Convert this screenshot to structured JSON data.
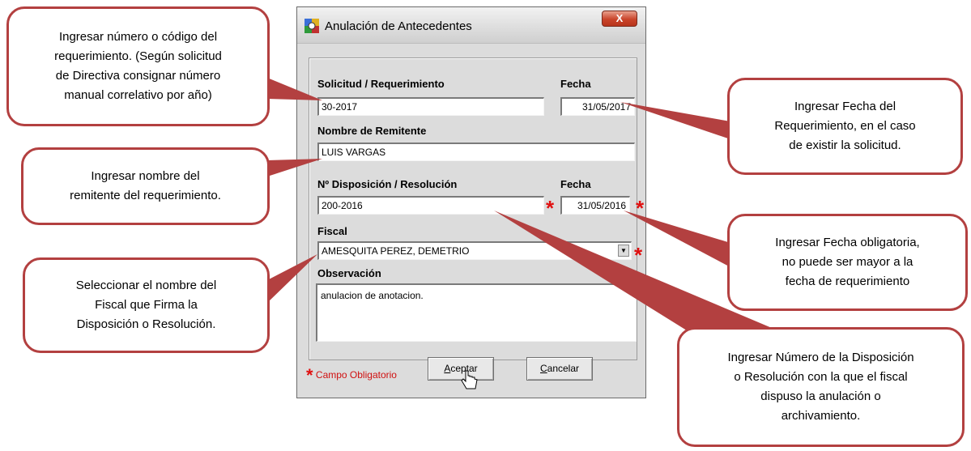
{
  "dialog": {
    "title": "Anulación de Antecedentes",
    "close_symbol": "X",
    "icon": "app-icon"
  },
  "form": {
    "solicitud_label": "Solicitud / Requerimiento",
    "solicitud_value": "30-2017",
    "fecha1_label": "Fecha",
    "fecha1_value": "31/05/2017",
    "remitente_label": "Nombre de Remitente",
    "remitente_value": "LUIS VARGAS",
    "disposicion_label": "Nº Disposición / Resolución",
    "disposicion_value": "200-2016",
    "fecha2_label": "Fecha",
    "fecha2_value": "31/05/2016",
    "fiscal_label": "Fiscal",
    "fiscal_value": "AMESQUITA PEREZ, DEMETRIO",
    "observacion_label": "Observación",
    "observacion_value": "anulacion de anotacion.",
    "required_star": "*",
    "required_note": "Campo Obligatorio"
  },
  "buttons": {
    "accept_underlined": "A",
    "accept_rest": "ceptar",
    "cancel_underlined": "C",
    "cancel_rest": "ancelar"
  },
  "callouts": {
    "c1": [
      "Ingresar número o código del",
      "requerimiento. (Según solicitud",
      "de Directiva consignar  número",
      "manual correlativo por año)"
    ],
    "c2": [
      "Ingresar nombre del",
      "remitente del requerimiento."
    ],
    "c3": [
      "Seleccionar el nombre del",
      "Fiscal que Firma la",
      "Disposición o Resolución."
    ],
    "c4": [
      "Ingresar Fecha del",
      "Requerimiento, en el caso",
      "de existir la solicitud."
    ],
    "c5": [
      "Ingresar Fecha obligatoria,",
      "no puede ser mayor a la",
      "fecha de requerimiento"
    ],
    "c6": [
      "Ingresar Número de la Disposición",
      "o Resolución con la que el fiscal",
      "dispuso la anulación o",
      "archivamiento."
    ]
  },
  "colors": {
    "callout_border": "#b34040",
    "required": "#e01010"
  }
}
